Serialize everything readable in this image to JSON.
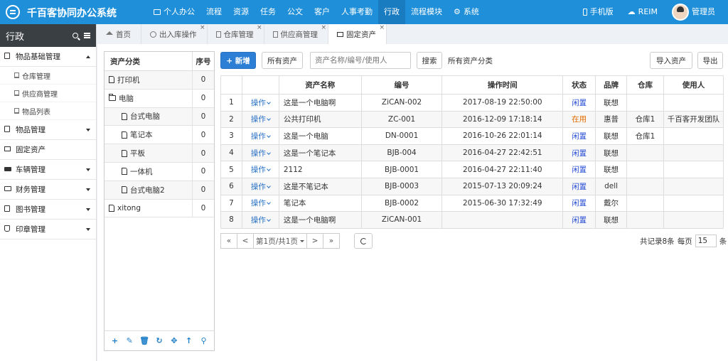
{
  "app": {
    "title": "千百客协同办公系统",
    "nav": [
      {
        "label": "个人办公",
        "icon": "monitor-icon"
      },
      {
        "label": "流程"
      },
      {
        "label": "资源"
      },
      {
        "label": "任务"
      },
      {
        "label": "公文"
      },
      {
        "label": "客户"
      },
      {
        "label": "人事考勤"
      },
      {
        "label": "行政",
        "active": true
      },
      {
        "label": "流程模块"
      },
      {
        "label": "系统",
        "icon": "gear-icon"
      }
    ],
    "right": {
      "mobile": "手机版",
      "reim": "REIM",
      "user": "管理员"
    }
  },
  "sidebar": {
    "title": "行政",
    "groups": [
      {
        "label": "物品基础管理",
        "icon": "book-icon",
        "expanded": true,
        "children": [
          "仓库管理",
          "供应商管理",
          "物品列表"
        ]
      },
      {
        "label": "物品管理",
        "icon": "book-icon",
        "expanded": false
      },
      {
        "label": "固定资产",
        "icon": "monitor-icon",
        "expanded": false,
        "nocaret": true
      },
      {
        "label": "车辆管理",
        "icon": "truck-icon",
        "expanded": false
      },
      {
        "label": "财务管理",
        "icon": "money-icon",
        "expanded": false
      },
      {
        "label": "图书管理",
        "icon": "book-icon",
        "expanded": false
      },
      {
        "label": "印章管理",
        "icon": "stamp-icon",
        "expanded": false
      }
    ]
  },
  "tabs": [
    {
      "label": "首页",
      "icon": "home-icon",
      "closable": false
    },
    {
      "label": "出入库操作",
      "icon": "plus-circle-icon",
      "closable": true
    },
    {
      "label": "仓库管理",
      "icon": "bookmark-icon",
      "closable": true
    },
    {
      "label": "供应商管理",
      "icon": "bookmark-icon",
      "closable": true
    },
    {
      "label": "固定资产",
      "icon": "monitor-icon",
      "closable": true,
      "active": true
    }
  ],
  "tree": {
    "headers": {
      "name": "资产分类",
      "order": "序号"
    },
    "rows": [
      {
        "label": "打印机",
        "order": "0",
        "icon": "file-icon",
        "level": 0
      },
      {
        "label": "电脑",
        "order": "0",
        "icon": "folder-icon",
        "level": 0
      },
      {
        "label": "台式电脑",
        "order": "0",
        "icon": "file-icon",
        "level": 1
      },
      {
        "label": "笔记本",
        "order": "0",
        "icon": "file-icon",
        "level": 1
      },
      {
        "label": "平板",
        "order": "0",
        "icon": "file-icon",
        "level": 1
      },
      {
        "label": "一体机",
        "order": "0",
        "icon": "file-icon",
        "level": 1
      },
      {
        "label": "台式电脑2",
        "order": "0",
        "icon": "file-icon",
        "level": 1
      },
      {
        "label": "xitong",
        "order": "0",
        "icon": "file-icon",
        "level": 0
      }
    ],
    "toolbar": [
      "add-icon",
      "edit-icon",
      "delete-icon",
      "refresh-icon",
      "move-icon",
      "up-icon",
      "search-icon"
    ]
  },
  "toolbar": {
    "add_label": "+ 新增",
    "all_assets_label": "所有资产",
    "search_placeholder": "资产名称/编号/使用人",
    "search_label": "搜索",
    "category_label": "所有资产分类",
    "import_label": "导入资产",
    "export_label": "导出"
  },
  "table": {
    "headers": [
      "",
      "",
      "资产名称",
      "编号",
      "操作时间",
      "状态",
      "品牌",
      "仓库",
      "使用人"
    ],
    "op_label": "操作",
    "rows": [
      {
        "n": "1",
        "name": "这是一个电脑啊",
        "code": "ZiCAN-002",
        "time": "2017-08-19 22:50:00",
        "status": "闲置",
        "brand": "联想",
        "warehouse": "",
        "user": ""
      },
      {
        "n": "2",
        "name": "公共打印机",
        "code": "ZC-001",
        "time": "2016-12-09 17:18:14",
        "status": "在用",
        "brand": "惠普",
        "warehouse": "仓库1",
        "user": "千百客开发团队"
      },
      {
        "n": "3",
        "name": "这是一个电脑",
        "code": "DN-0001",
        "time": "2016-10-26 22:01:14",
        "status": "闲置",
        "brand": "联想",
        "warehouse": "仓库1",
        "user": ""
      },
      {
        "n": "4",
        "name": "这是一个笔记本",
        "code": "BJB-004",
        "time": "2016-04-27 22:42:51",
        "status": "闲置",
        "brand": "联想",
        "warehouse": "",
        "user": ""
      },
      {
        "n": "5",
        "name": "2112",
        "code": "BJB-0001",
        "time": "2016-04-27 22:11:40",
        "status": "闲置",
        "brand": "联想",
        "warehouse": "",
        "user": ""
      },
      {
        "n": "6",
        "name": "这是不笔记本",
        "code": "BJB-0003",
        "time": "2015-07-13 20:09:24",
        "status": "闲置",
        "brand": "dell",
        "warehouse": "",
        "user": ""
      },
      {
        "n": "7",
        "name": "笔记本",
        "code": "BJB-0002",
        "time": "2015-06-30 17:32:49",
        "status": "闲置",
        "brand": "戴尔",
        "warehouse": "",
        "user": ""
      },
      {
        "n": "8",
        "name": "这是一个电脑啊",
        "code": "ZiCAN-001",
        "time": "",
        "status": "闲置",
        "brand": "联想",
        "warehouse": "",
        "user": ""
      }
    ]
  },
  "pager": {
    "first": "«",
    "prev": "<",
    "page_label": "第1页/共1页",
    "next": ">",
    "last": "»",
    "total_label": "共记录8条",
    "per_page_label": "每页",
    "per_page": "15",
    "unit": "条"
  },
  "colors": {
    "primary": "#1e8fd8",
    "idle": "#2a4fd6",
    "in_use": "#e06b00"
  }
}
